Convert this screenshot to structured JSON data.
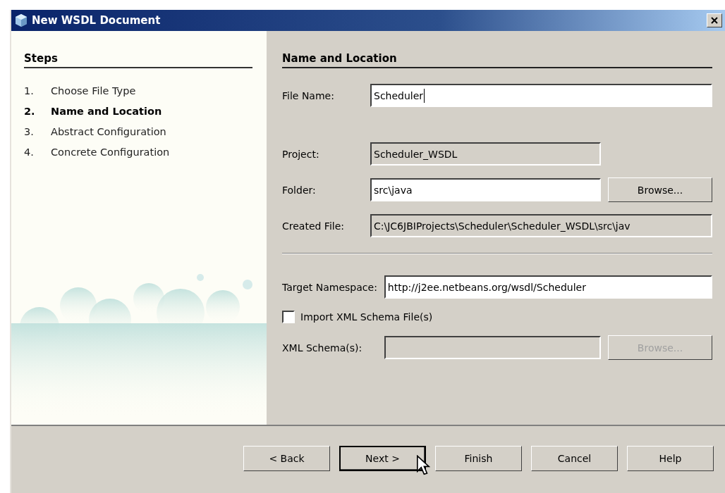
{
  "window": {
    "title": "New WSDL Document"
  },
  "steps": {
    "title": "Steps",
    "items": [
      {
        "number": "1.",
        "label": "Choose File Type",
        "selected": false
      },
      {
        "number": "2.",
        "label": "Name and Location",
        "selected": true
      },
      {
        "number": "3.",
        "label": "Abstract Configuration",
        "selected": false
      },
      {
        "number": "4.",
        "label": "Concrete Configuration",
        "selected": false
      }
    ]
  },
  "panel": {
    "title": "Name and Location",
    "groups": [
      {
        "rows": [
          {
            "kind": "input",
            "label": "File Name:",
            "value": "Scheduler",
            "editable": true,
            "focused": true
          }
        ]
      },
      {
        "rows": [
          {
            "kind": "input",
            "label": "Project:",
            "value": "Scheduler_WSDL",
            "editable": false,
            "short": true
          },
          {
            "kind": "input",
            "label": "Folder:",
            "value": "src\\java",
            "editable": true,
            "button": {
              "label": "Browse...",
              "disabled": false
            }
          },
          {
            "kind": "input",
            "label": "Created File:",
            "value": "C:\\JC6JBIProjects\\Scheduler\\Scheduler_WSDL\\src\\jav",
            "editable": false
          }
        ]
      },
      {
        "divider_before": true,
        "rows": [
          {
            "kind": "input",
            "label": "Target Namespace:",
            "value": "http://j2ee.netbeans.org/wsdl/Scheduler",
            "editable": true
          },
          {
            "kind": "checkbox",
            "label": "Import XML Schema File(s)",
            "checked": false
          },
          {
            "kind": "input",
            "label": "XML Schema(s):",
            "editable": false,
            "button": {
              "label": "Browse...",
              "disabled": true
            }
          }
        ]
      }
    ]
  },
  "buttons": [
    {
      "label": "< Back",
      "default": false
    },
    {
      "label": "Next >",
      "default": true
    },
    {
      "label": "Finish",
      "default": false
    },
    {
      "label": "Cancel",
      "default": false
    },
    {
      "label": "Help",
      "default": false
    }
  ]
}
